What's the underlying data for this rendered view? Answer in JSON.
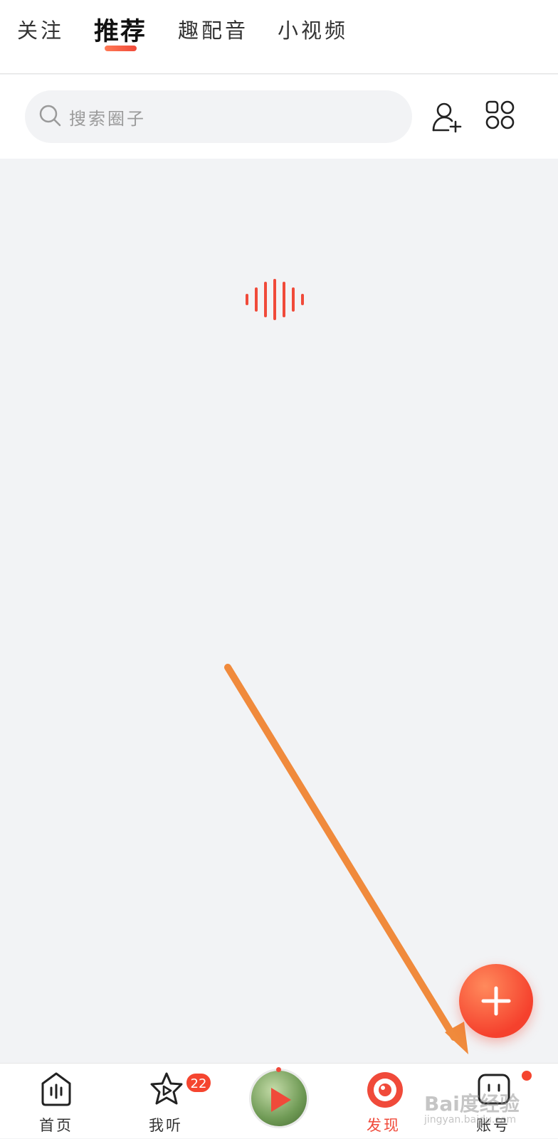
{
  "top_tabs": {
    "follow": "关注",
    "recommend": "推荐",
    "dubbing": "趣配音",
    "short_video": "小视频"
  },
  "search": {
    "placeholder": "搜索圈子"
  },
  "bottom_nav": {
    "home": "首页",
    "listen": "我听",
    "listen_badge": "22",
    "discover": "发现",
    "account": "账号"
  },
  "watermark": {
    "brand": "Bai度经验",
    "url": "jingyan.baidu.com"
  },
  "colors": {
    "accent": "#f04a3a",
    "annotation_arrow": "#f08a3c",
    "background": "#f2f3f5"
  }
}
